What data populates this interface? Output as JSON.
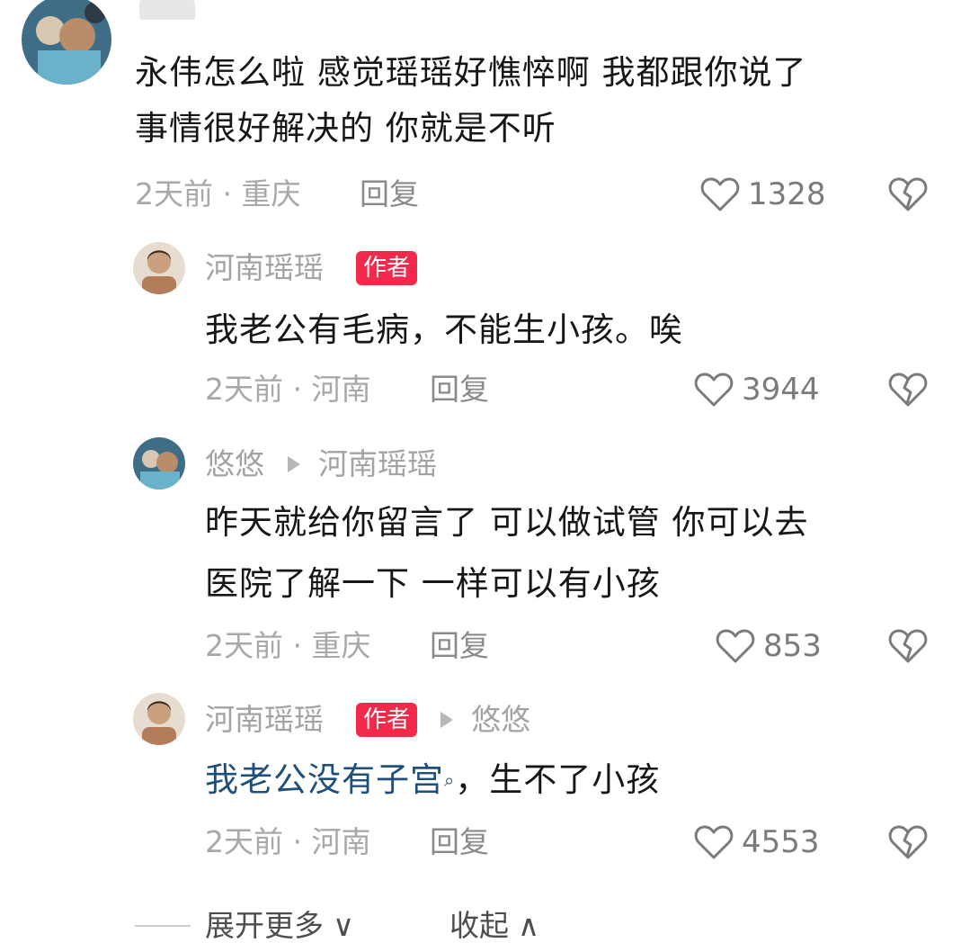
{
  "comments": [
    {
      "name": "",
      "text_lines": [
        "永伟怎么啦 感觉瑶瑶好憔悴啊 我都跟你说了",
        "事情很好解决的 你就是不听"
      ],
      "meta": "2天前 · 重庆",
      "reply": "回复",
      "likes": "1328"
    }
  ],
  "replies": [
    {
      "name": "河南瑶瑶",
      "badge": "作者",
      "text": "我老公有毛病，不能生小孩。唉",
      "meta": "2天前 · 河南",
      "reply": "回复",
      "likes": "3944"
    },
    {
      "name": "悠悠",
      "reply_to": "河南瑶瑶",
      "text_lines": [
        "昨天就给你留言了 可以做试管 你可以去",
        "医院了解一下 一样可以有小孩"
      ],
      "meta": "2天前 · 重庆",
      "reply": "回复",
      "likes": "853"
    },
    {
      "name": "河南瑶瑶",
      "badge": "作者",
      "reply_to": "悠悠",
      "text_link": "我老公没有子宫",
      "text_rest": "，生不了小孩",
      "meta": "2天前 · 河南",
      "reply": "回复",
      "likes": "4553"
    }
  ],
  "footer": {
    "expand_more": "展开更多",
    "collapse": "收起"
  },
  "icons": {
    "like": "heart-outline-icon",
    "dislike": "broken-heart-icon",
    "expand": "chevron-down-icon",
    "collapse": "chevron-up-icon",
    "search": "search-icon"
  },
  "colors": {
    "badge": "#f2294a",
    "link": "#1f4f7a",
    "meta": "#a8a8a8"
  }
}
